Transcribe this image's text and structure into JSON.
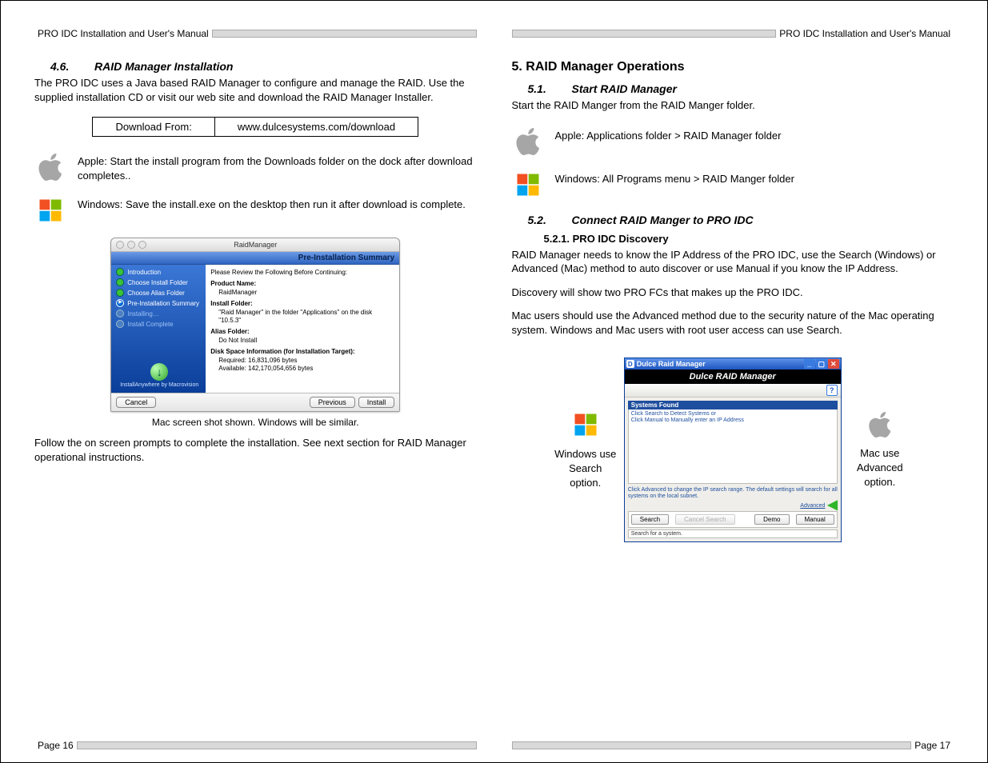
{
  "doc_title": "PRO IDC Installation and User's Manual",
  "left_page_no": "Page 16",
  "right_page_no": "Page 17",
  "left": {
    "sec46_num": "4.6.",
    "sec46_title": "RAID Manager Installation",
    "intro": "The PRO IDC uses a Java based RAID Manager to configure and manage the RAID.  Use the supplied installation CD or visit our web site and download the RAID Manager Installer.",
    "dl_label": "Download From:",
    "dl_url": "www.dulcesystems.com/download",
    "apple_instr": "Apple: Start the install program from the Downloads folder on the dock after download completes..",
    "win_instr": "Windows: Save the install.exe on the desktop then run it after download is complete.",
    "mac_window": {
      "title": "RaidManager",
      "banner": "Pre-Installation Summary",
      "steps": [
        "Introduction",
        "Choose Install Folder",
        "Choose Alias Folder",
        "Pre-Installation Summary"
      ],
      "steps_muted": [
        "Installing…",
        "Install Complete"
      ],
      "brand": "InstallAnywhere by Macrovision",
      "main_hdr": "Please Review the Following Before Continuing:",
      "prod_lbl": "Product Name:",
      "prod_val": "RaidManager",
      "folder_lbl": "Install Folder:",
      "folder_val1": "\"Raid Manager\" in the folder \"Applications\" on the disk",
      "folder_val2": "\"10.5.3\"",
      "alias_lbl": "Alias Folder:",
      "alias_val": "Do Not Install",
      "disk_lbl": "Disk Space Information (for Installation Target):",
      "disk_req": "Required: 16,831,096 bytes",
      "disk_avail": "Available: 142,170,054,656 bytes",
      "btn_cancel": "Cancel",
      "btn_prev": "Previous",
      "btn_install": "Install"
    },
    "caption": "Mac screen shot shown.  Windows will be similar.",
    "follow": "Follow the on screen prompts to complete the installation.  See next section for RAID Manager operational instructions."
  },
  "right": {
    "h1": "5. RAID Manager Operations",
    "sec51_num": "5.1.",
    "sec51_title": "Start RAID Manager",
    "sec51_body": "Start the RAID Manger from the RAID Manger folder.",
    "apple_path": "Apple: Applications folder > RAID Manager folder",
    "win_path": "Windows: All Programs menu > RAID Manger folder",
    "sec52_num": "5.2.",
    "sec52_title": "Connect RAID Manger to PRO IDC",
    "sec521_title": "5.2.1. PRO IDC Discovery",
    "p1": "RAID Manager needs to know the IP Address of the PRO IDC, use the Search (Windows) or Advanced (Mac) method to auto discover or use Manual if you know the IP Address.",
    "p2": "Discovery will show two PRO FCs that makes up the PRO IDC.",
    "p3": "Mac users should use the Advanced method due to the security nature of the Mac operating system.  Windows and Mac users with root user access can use Search.",
    "left_note": "Windows use Search option.",
    "right_note": "Mac use Advanced option.",
    "dulce": {
      "app_title": "Dulce Raid Manager",
      "banner": "Dulce RAID Manager",
      "sys_found": "Systems Found",
      "hint1": "Click Search to Detect Systems or",
      "hint2": "Click Manual to Manually enter an IP Address",
      "adv_txt": "Click Advanced to change the IP search range. The default settings will search for all systems on the local subnet.",
      "adv_link": "Advanced",
      "btn_search": "Search",
      "btn_cancel_search": "Cancel Search",
      "btn_demo": "Demo",
      "btn_manual": "Manual",
      "status": "Search for a system."
    }
  }
}
